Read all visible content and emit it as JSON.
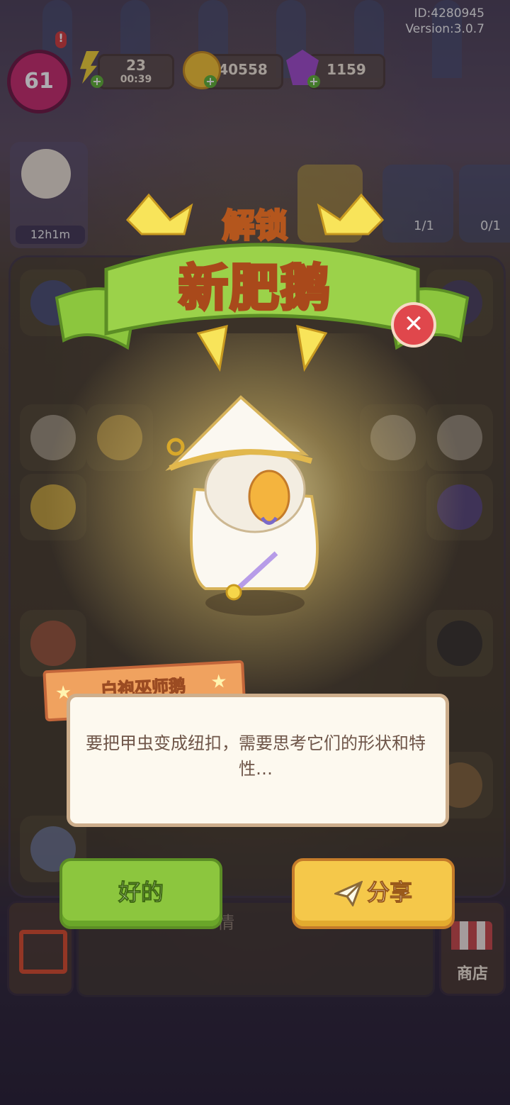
{
  "hud": {
    "player_level": "61",
    "energy": "23",
    "energy_timer": "00:39",
    "coins": "40558",
    "gems": "1159",
    "id_line": "ID:4280945",
    "version_line": "Version:3.0.7"
  },
  "scene": {
    "customer_timer": "12h1m",
    "quest_progress_1": "1/1",
    "quest_progress_2": "0/1",
    "bottom_bar_hint": "情",
    "shop_label": "商店"
  },
  "unlock_popup": {
    "subtitle": "解锁",
    "title": "新肥鹅",
    "character_name": "白袍巫师鹅",
    "description": "要把甲虫变成纽扣，需要思考它们的形状和特性…",
    "ok_button": "好的",
    "share_button": "分享"
  },
  "colors": {
    "ok_green": "#8cc63e",
    "share_yellow": "#f5c84a",
    "close_red": "#e0474c",
    "ribbon_green": "#9bd24a"
  },
  "icons": [
    "level-badge-icon",
    "energy-icon",
    "coin-icon",
    "gem-icon",
    "close-icon",
    "paper-plane-icon",
    "exit-door-icon",
    "shop-icon",
    "star-icon"
  ]
}
